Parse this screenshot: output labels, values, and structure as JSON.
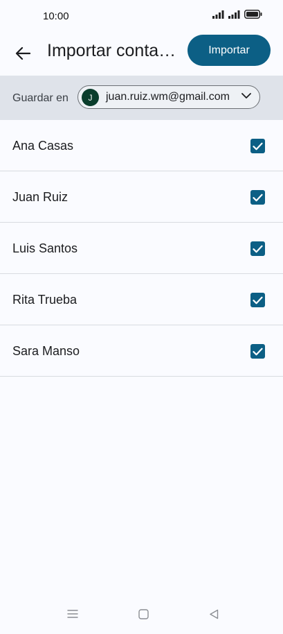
{
  "status_bar": {
    "time": "10:00",
    "icons": [
      "signal-icon",
      "signal-icon",
      "battery-icon"
    ]
  },
  "app_bar": {
    "back_icon": "arrow-left-icon",
    "title": "Importar conta…",
    "import_label": "Importar"
  },
  "save_in": {
    "label": "Guardar en",
    "account_initial": "J",
    "account_email": "juan.ruiz.wm@gmail.com",
    "dropdown_icon": "chevron-down-icon"
  },
  "contacts": [
    {
      "name": "Ana Casas",
      "checked": true
    },
    {
      "name": "Juan Ruiz",
      "checked": true
    },
    {
      "name": "Luis Santos",
      "checked": true
    },
    {
      "name": "Rita Trueba",
      "checked": true
    },
    {
      "name": "Sara Manso",
      "checked": true
    }
  ],
  "nav_bar": {
    "icons": [
      "menu-icon",
      "home-icon",
      "back-triangle-icon"
    ]
  },
  "colors": {
    "accent": "#0c5f85",
    "save_bar_bg": "#dfe3ea",
    "avatar_bg": "#0a3d2c",
    "page_bg": "#fafbff"
  }
}
